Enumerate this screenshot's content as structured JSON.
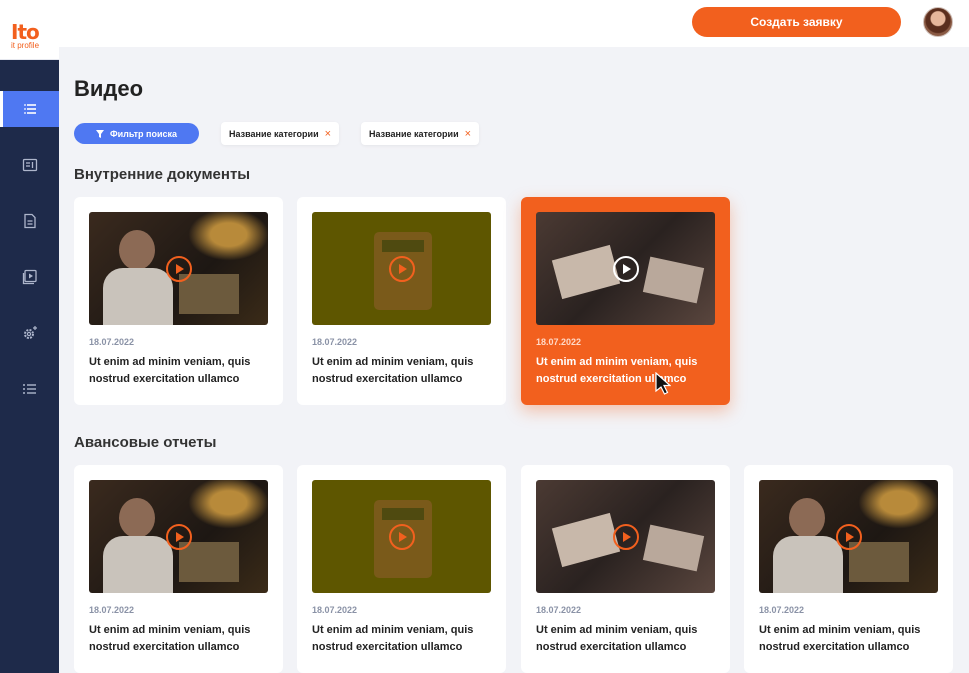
{
  "brand": {
    "logo_mark": "Ito",
    "logo_text": "it profile"
  },
  "header": {
    "cta_label": "Создать заявку"
  },
  "sidebar": {
    "items": [
      {
        "name": "menu",
        "active": true
      },
      {
        "name": "cards",
        "active": false
      },
      {
        "name": "document",
        "active": false
      },
      {
        "name": "video",
        "active": false
      },
      {
        "name": "settings",
        "active": false
      },
      {
        "name": "list",
        "active": false
      }
    ]
  },
  "page": {
    "title": "Видео"
  },
  "filters": {
    "button_label": "Фильтр поиска",
    "chips": [
      {
        "label": "Название категории",
        "remove": "×"
      },
      {
        "label": "Название категории",
        "remove": "×"
      }
    ]
  },
  "sections": [
    {
      "title": "Внутренние документы",
      "cards": [
        {
          "date": "18.07.2022",
          "title": "Ut enim ad minim veniam, quis nostrud exercitation ullamco",
          "thumb": "man-at-laptop",
          "active": false
        },
        {
          "date": "18.07.2022",
          "title": "Ut enim ad minim veniam, quis nostrud exercitation ullamco",
          "thumb": "calculator",
          "active": false
        },
        {
          "date": "18.07.2022",
          "title": "Ut enim ad minim veniam, quis nostrud exercitation ullamco",
          "thumb": "money-hands",
          "active": true
        }
      ]
    },
    {
      "title": "Авансовые отчеты",
      "cards": [
        {
          "date": "18.07.2022",
          "title": "Ut enim ad minim veniam, quis nostrud exercitation ullamco",
          "thumb": "man-at-laptop",
          "active": false
        },
        {
          "date": "18.07.2022",
          "title": "Ut enim ad minim veniam, quis nostrud exercitation ullamco",
          "thumb": "calculator",
          "active": false
        },
        {
          "date": "18.07.2022",
          "title": "Ut enim ad minim veniam, quis nostrud exercitation ullamco",
          "thumb": "money-hands",
          "active": false
        },
        {
          "date": "18.07.2022",
          "title": "Ut enim ad minim veniam, quis nostrud exercitation ullamco",
          "thumb": "man-at-laptop",
          "active": false
        }
      ]
    }
  ],
  "colors": {
    "accent": "#f2601e",
    "primary": "#4f78f2",
    "sidebar": "#1e2a4a",
    "background": "#f2f3f7"
  }
}
